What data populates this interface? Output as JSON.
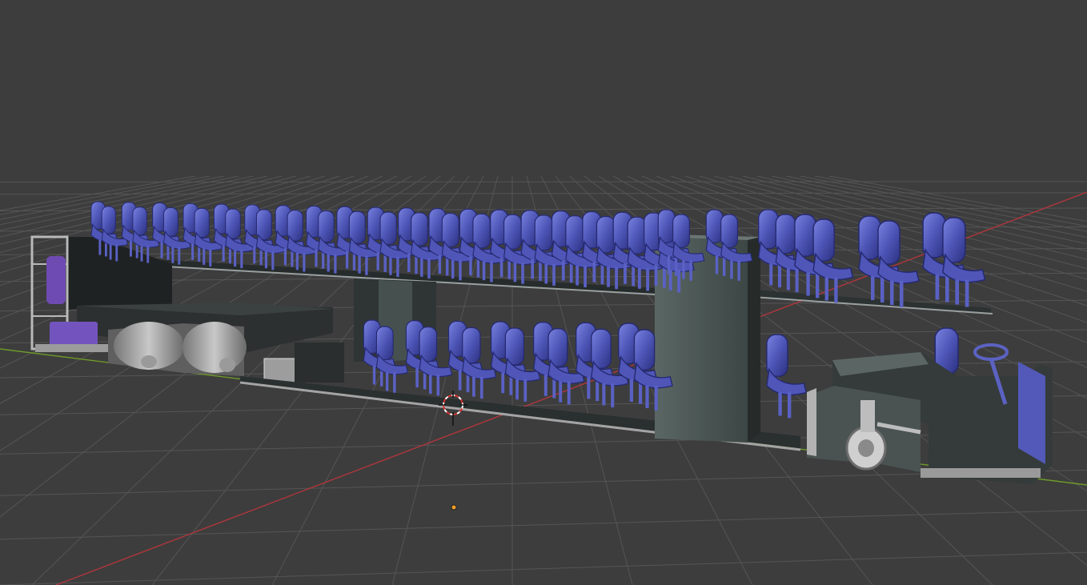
{
  "app": {
    "name": "3D viewport"
  },
  "viewport": {
    "background": "#3d3d3d",
    "grid_color": "#555555",
    "x_axis_color": "#b0363c",
    "y_axis_color": "#6e9a2a",
    "seat_color": "#4f56b8",
    "hull_color": "#3f4a48",
    "frame_color": "#b9b9b9"
  },
  "scene": {
    "upper_deck_seat_rows": 19,
    "lower_deck_seat_rows": 7,
    "cursor_icon": "3d-cursor-icon",
    "origin_icon": "object-origin-icon"
  }
}
